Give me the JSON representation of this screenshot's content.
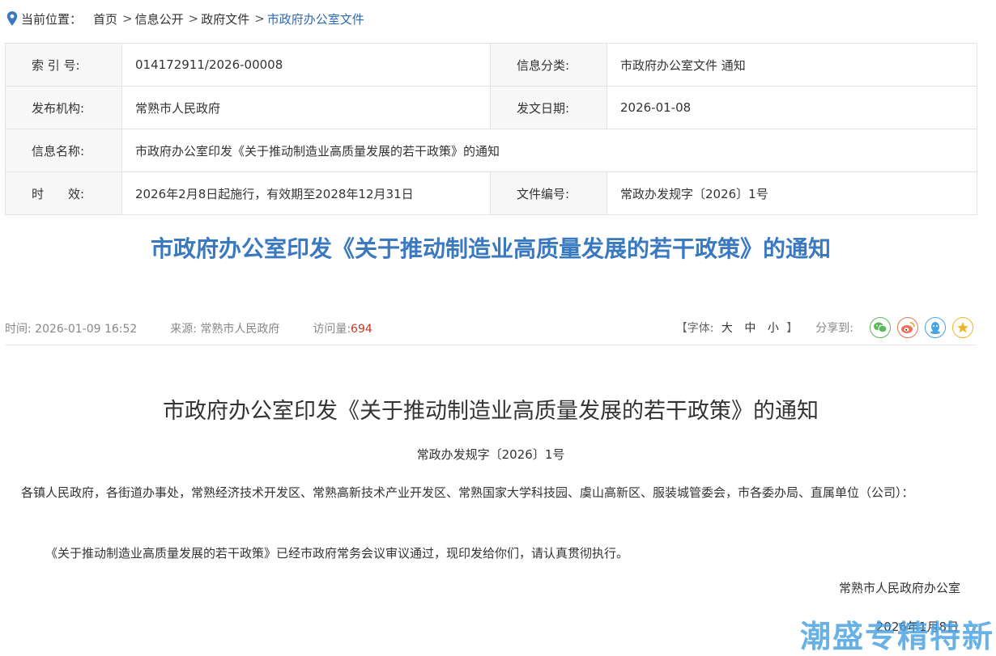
{
  "breadcrumb": {
    "label": "当前位置：",
    "items": [
      "首页",
      "信息公开",
      "政府文件",
      "市政府办公室文件"
    ],
    "sep": ">"
  },
  "meta": {
    "index_label": "索 引 号:",
    "index_value": "014172911/2026-00008",
    "category_label": "信息分类:",
    "category_value": "市政府办公室文件 通知",
    "publisher_label": "发布机构:",
    "publisher_value": "常熟市人民政府",
    "issue_date_label": "发文日期:",
    "issue_date_value": "2026-01-08",
    "name_label": "信息名称:",
    "name_value": "市政府办公室印发《关于推动制造业高质量发展的若干政策》的通知",
    "validity_label": "时　　效:",
    "validity_value": "2026年2月8日起施行，有效期至2028年12月31日",
    "doc_no_label": "文件编号:",
    "doc_no_value": "常政办发规字〔2026〕1号"
  },
  "title": "市政府办公室印发《关于推动制造业高质量发展的若干政策》的通知",
  "info": {
    "time_label": "时间:",
    "time_value": "2026-01-09 16:52",
    "source_label": "来源:",
    "source_value": "常熟市人民政府",
    "visits_label": "访问量:",
    "visits_value": "694",
    "font_prefix": "【字体:",
    "font_large": "大",
    "font_medium": "中",
    "font_small": "小",
    "font_suffix": "】",
    "share_label": "分享到:"
  },
  "colors": {
    "accent": "#3a78c0",
    "breadcrumb_current": "#2f6bb3",
    "visits": "#c0392b"
  },
  "share_icons": [
    "wechat-icon",
    "weibo-icon",
    "qq-icon",
    "qzone-icon"
  ],
  "document": {
    "title": "市政府办公室印发《关于推动制造业高质量发展的若干政策》的通知",
    "number": "常政办发规字〔2026〕1号",
    "addressee": "各镇人民政府，各街道办事处，常熟经济技术开发区、常熟高新技术产业开发区、常熟国家大学科技园、虞山高新区、服装城管委会，市各委办局、直属单位（公司）：",
    "body": "《关于推动制造业高质量发展的若干政策》已经市政府常务会议审议通过，现印发给你们，请认真贯彻执行。",
    "signer": "常熟市人民政府办公室",
    "date": "2026年1月8日"
  },
  "watermark": "潮盛专精特新"
}
